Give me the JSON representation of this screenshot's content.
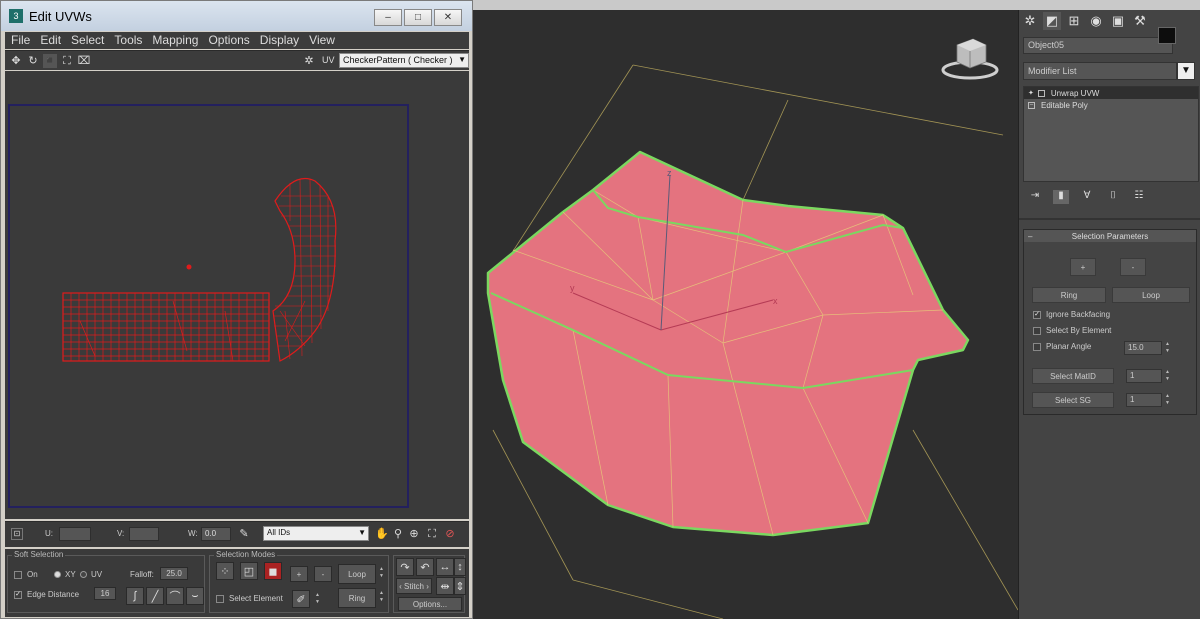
{
  "window": {
    "title": "Edit UVWs",
    "minimize": "‒",
    "maximize": "□",
    "close": "✕"
  },
  "menu": [
    "File",
    "Edit",
    "Select",
    "Tools",
    "Mapping",
    "Options",
    "Display",
    "View"
  ],
  "toolbar": {
    "uv_label": "UV",
    "texture_select": "CheckerPattern  ( Checker )"
  },
  "statusbar": {
    "u_label": "U:",
    "v_label": "V:",
    "w_label": "W:",
    "w_value": "0.0",
    "ids_select": "All IDs"
  },
  "soft_selection": {
    "title": "Soft Selection",
    "on": "On",
    "xy": "XY",
    "uv": "UV",
    "falloff_label": "Falloff:",
    "falloff_value": "25.0",
    "edge_distance": "Edge Distance",
    "edge_distance_value": "16"
  },
  "selection_modes": {
    "title": "Selection Modes",
    "select_element": "Select Element",
    "plus": "+",
    "minus": "-",
    "loop": "Loop",
    "ring": "Ring"
  },
  "bottom_right": {
    "stitch": "‹ Stitch ›",
    "options": "Options..."
  },
  "command_panel": {
    "object_name": "Object05",
    "modifier_list": "Modifier List",
    "stack": [
      "Unwrap UVW",
      "Editable Poly"
    ],
    "rollout_title": "Selection Parameters",
    "plus": "+",
    "minus": "-",
    "ring": "Ring",
    "loop": "Loop",
    "ignore_backfacing": "Ignore Backfacing",
    "select_by_element": "Select By Element",
    "planar_angle": "Planar Angle",
    "planar_angle_value": "15.0",
    "select_matid": "Select MatID",
    "matid_value": "1",
    "select_sg": "Select SG",
    "sg_value": "1"
  },
  "viewport": {
    "axis_x": "x",
    "axis_y": "y",
    "axis_z": "z"
  },
  "colors": {
    "mesh_fill": "#e4737f",
    "mesh_edges_selected": "#7bd860",
    "mesh_wire": "#e7c77a",
    "uv_wire": "#e01b1b",
    "uv_border": "#23205e"
  }
}
